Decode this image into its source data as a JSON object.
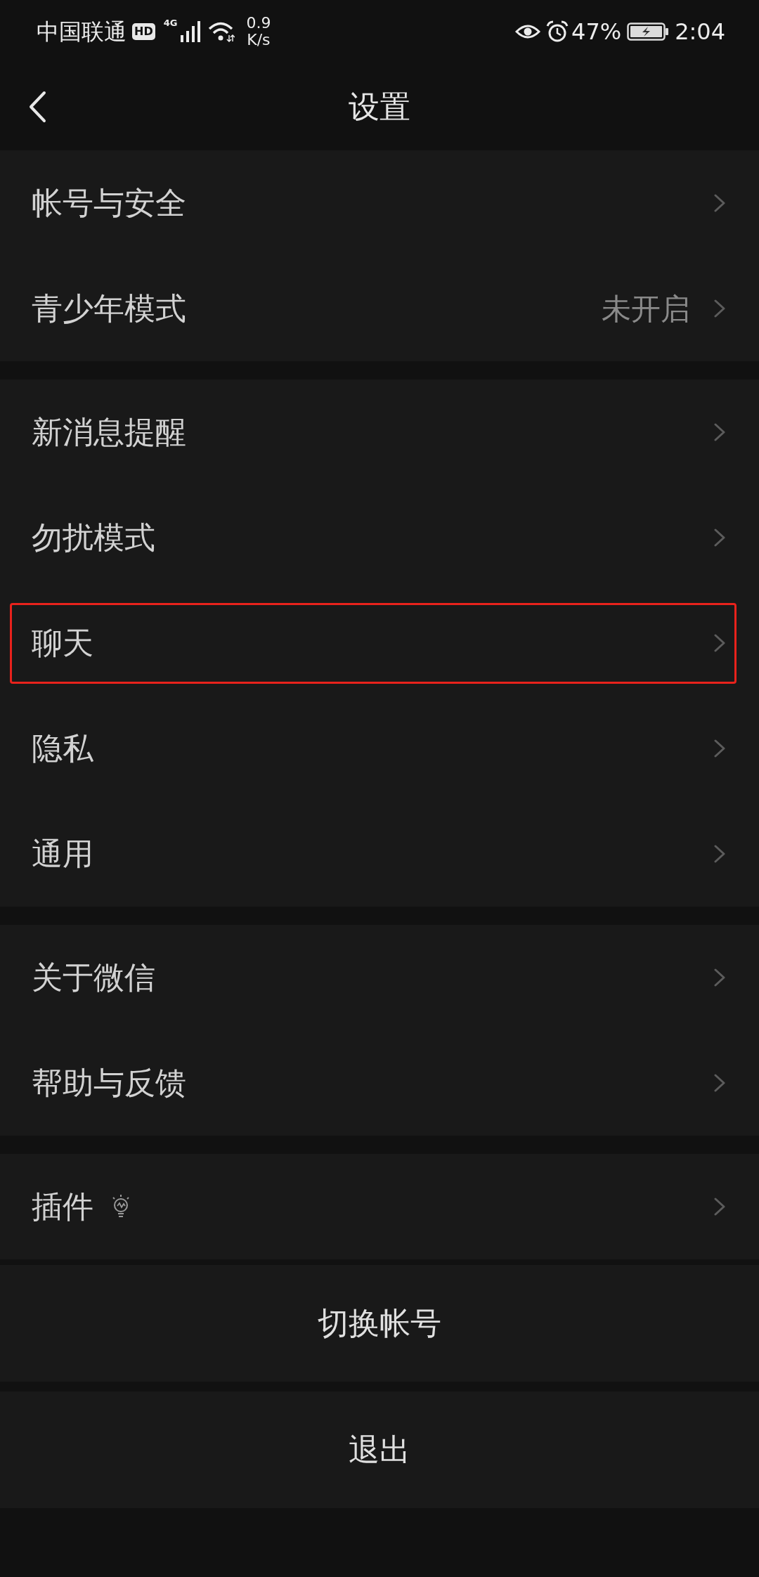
{
  "status_bar": {
    "carrier": "中国联通",
    "hd_badge": "HD",
    "network_type": "4G",
    "speed_value": "0.9",
    "speed_unit": "K/s",
    "battery_percent": "47%",
    "time": "2:04"
  },
  "header": {
    "title": "设置"
  },
  "groups": [
    {
      "items": [
        {
          "kind": "plain",
          "label": "帐号与安全",
          "highlighted": false
        },
        {
          "kind": "plain",
          "label": "青少年模式",
          "value": "未开启",
          "highlighted": false
        }
      ]
    },
    {
      "items": [
        {
          "kind": "plain",
          "label": "新消息提醒",
          "highlighted": false
        },
        {
          "kind": "plain",
          "label": "勿扰模式",
          "highlighted": false
        },
        {
          "kind": "plain",
          "label": "聊天",
          "highlighted": true
        },
        {
          "kind": "plain",
          "label": "隐私",
          "highlighted": false
        },
        {
          "kind": "plain",
          "label": "通用",
          "highlighted": false
        }
      ]
    },
    {
      "items": [
        {
          "kind": "plain",
          "label": "关于微信",
          "highlighted": false
        },
        {
          "kind": "plain",
          "label": "帮助与反馈",
          "highlighted": false
        }
      ]
    },
    {
      "items": [
        {
          "kind": "icon",
          "label": "插件",
          "highlighted": false
        }
      ]
    }
  ],
  "buttons": [
    "切换帐号",
    "退出"
  ]
}
